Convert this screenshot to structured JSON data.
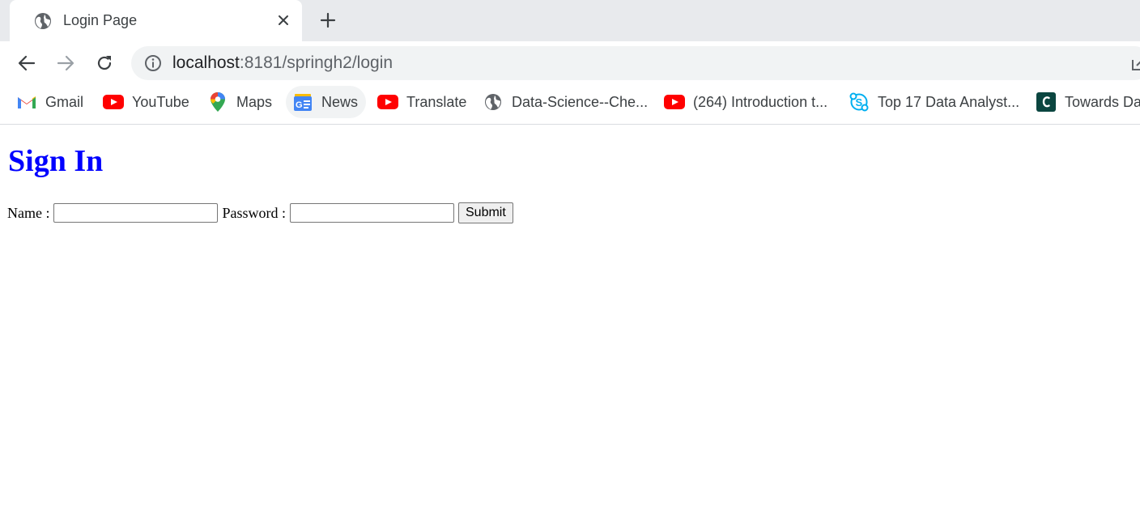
{
  "tab": {
    "title": "Login Page",
    "favicon": "globe-icon"
  },
  "toolbar": {
    "url_host": "localhost",
    "url_path": ":8181/springh2/login"
  },
  "bookmarks": [
    {
      "label": "Gmail",
      "icon": "gmail-icon"
    },
    {
      "label": "YouTube",
      "icon": "youtube-icon"
    },
    {
      "label": "Maps",
      "icon": "maps-icon"
    },
    {
      "label": "News",
      "icon": "news-icon"
    },
    {
      "label": "Translate",
      "icon": "youtube-icon"
    },
    {
      "label": "Data-Science--Che...",
      "icon": "globe-icon"
    },
    {
      "label": "(264) Introduction t...",
      "icon": "youtube-icon"
    },
    {
      "label": "Top 17 Data Analyst...",
      "icon": "skype-icon"
    },
    {
      "label": "Towards Dat",
      "icon": "towards-data-science-icon"
    }
  ],
  "page": {
    "heading": "Sign In",
    "name_label": "Name :",
    "password_label": "Password :",
    "name_value": "",
    "password_value": "",
    "submit_label": "Submit"
  },
  "colors": {
    "heading": "#0000ff",
    "tabstrip": "#e8eaed",
    "omnibox": "#f1f3f4"
  }
}
